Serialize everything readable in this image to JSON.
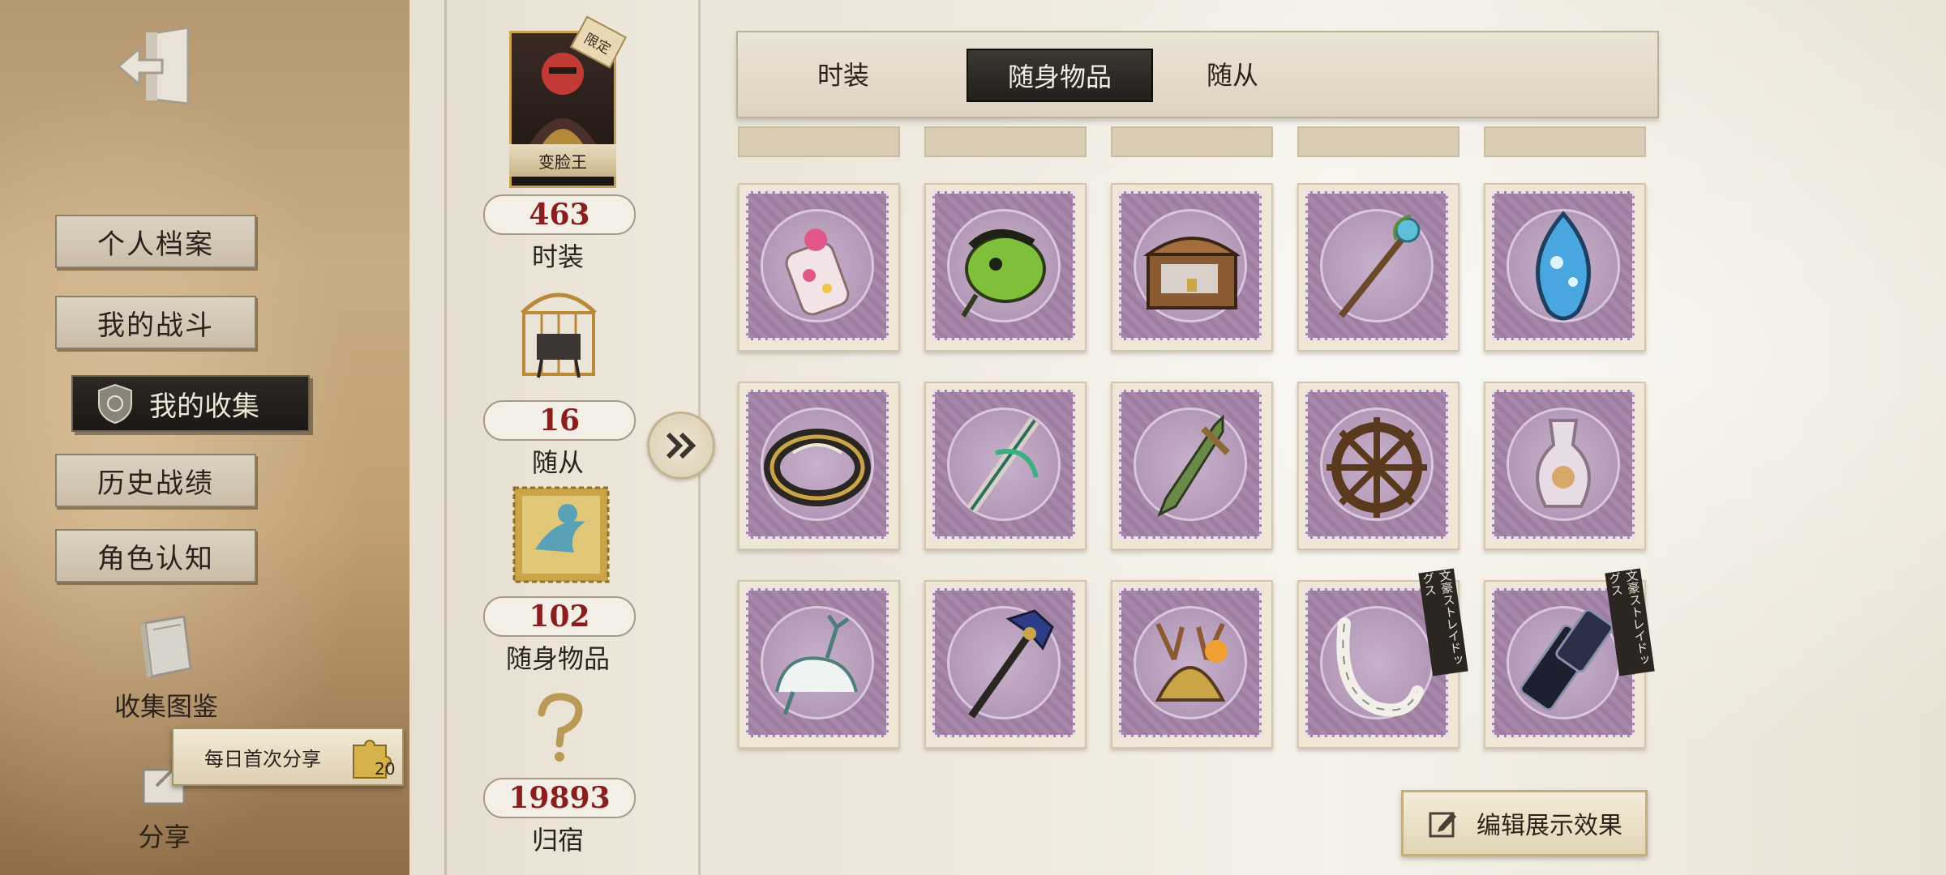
{
  "sidebar": {
    "menu": [
      {
        "label": "个人档案"
      },
      {
        "label": "我的战斗"
      },
      {
        "label": "我的收集"
      },
      {
        "label": "历史战绩"
      },
      {
        "label": "角色认知"
      }
    ],
    "collection_book_label": "收集图鉴",
    "share_label": "分享",
    "share_banner": "每日首次分享",
    "share_reward": "20"
  },
  "profile": {
    "portrait_name": "变脸王",
    "limited_tag": "限定",
    "stats": [
      {
        "value": "463",
        "label": "时装"
      },
      {
        "value": "16",
        "label": "随从"
      },
      {
        "value": "102",
        "label": "随身物品"
      },
      {
        "value": "19893",
        "label": "归宿"
      }
    ]
  },
  "tabs": [
    {
      "label": "时装"
    },
    {
      "label": "随身物品"
    },
    {
      "label": "随从"
    }
  ],
  "active_tab": "随身物品",
  "grid_items": [
    {
      "name": "bottle-charm",
      "icon": "bottle-icon"
    },
    {
      "name": "green-creature",
      "icon": "creature-icon"
    },
    {
      "name": "treasure-chest",
      "icon": "chest-icon"
    },
    {
      "name": "crystal-staff",
      "icon": "staff-icon"
    },
    {
      "name": "blue-gem-pendant",
      "icon": "gem-icon"
    },
    {
      "name": "golden-bracelet",
      "icon": "bracelet-icon"
    },
    {
      "name": "green-wand",
      "icon": "wand-icon"
    },
    {
      "name": "vine-dagger",
      "icon": "dagger-icon"
    },
    {
      "name": "ship-wheel",
      "icon": "wheel-icon"
    },
    {
      "name": "crystal-flask",
      "icon": "flask-icon"
    },
    {
      "name": "white-deer",
      "icon": "deer-icon"
    },
    {
      "name": "feather-scepter",
      "icon": "scepter-icon"
    },
    {
      "name": "antler-lantern",
      "icon": "antler-icon"
    },
    {
      "name": "white-tail",
      "icon": "tail-icon",
      "tag": "文豪ストレイドッグス"
    },
    {
      "name": "flip-phone",
      "icon": "phone-icon",
      "tag": "文豪ストレイドッグス"
    }
  ],
  "edit_button": "编辑展示效果",
  "colors": {
    "stamp_purple": "#a887ab",
    "stat_red": "#8a1e1e",
    "active_dark": "#2c2823"
  }
}
